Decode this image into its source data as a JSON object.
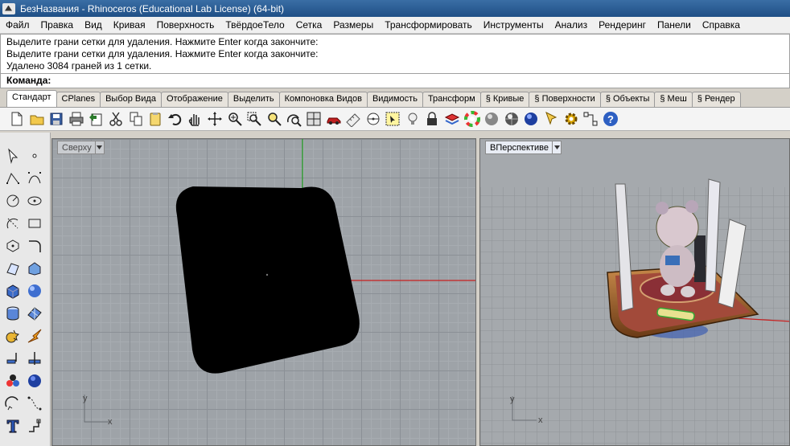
{
  "titlebar": {
    "title": "БезНазвания - Rhinoceros (Educational Lab License) (64-bit)"
  },
  "menu": [
    "Файл",
    "Правка",
    "Вид",
    "Кривая",
    "Поверхность",
    "ТвёрдоеТело",
    "Сетка",
    "Размеры",
    "Трансформировать",
    "Инструменты",
    "Анализ",
    "Рендеринг",
    "Панели",
    "Справка"
  ],
  "command": {
    "history": [
      "Выделите грани сетки для удаления. Нажмите Enter когда закончите:",
      "Выделите грани сетки для удаления. Нажмите Enter когда закончите:",
      "Удалено 3084 граней из 1 сетки."
    ],
    "prompt": "Команда:"
  },
  "tabs": [
    "Стандарт",
    "CPlanes",
    "Выбор Вида",
    "Отображение",
    "Выделить",
    "Компоновка Видов",
    "Видимость",
    "Трансформ",
    "§ Кривые",
    "§ Поверхности",
    "§ Объекты",
    "§ Меш",
    "§ Рендер"
  ],
  "toolbar_icons": [
    "new-icon",
    "open-icon",
    "save-icon",
    "print-icon",
    "import-icon",
    "cut-icon",
    "copy-icon",
    "paste-icon",
    "undo-icon",
    "pan-hand-icon",
    "rotate-view-icon",
    "zoom-dynamic-icon",
    "zoom-window-icon",
    "zoom-extents-icon",
    "zoom-selected-icon",
    "rotate-camera-icon",
    "four-viewports-icon",
    "car-icon",
    "measure-icon",
    "point-filter-icon",
    "select-icon",
    "light-bulb-icon",
    "lock-icon",
    "layer-icon",
    "color-wheel-icon",
    "shaded-sphere-icon",
    "rendered-sphere-icon",
    "blue-sphere-icon",
    "gumball-icon",
    "settings-gear-icon",
    "snap-grid-icon",
    "help-icon"
  ],
  "viewports": {
    "top": {
      "label": "Сверху"
    },
    "perspective": {
      "label": "ВПерспективе"
    },
    "axis_x": "x",
    "axis_y": "y"
  },
  "colors": {
    "x_axis": "#c82020",
    "y_axis": "#1e9a1e",
    "title_bar": "#1f4f86"
  }
}
